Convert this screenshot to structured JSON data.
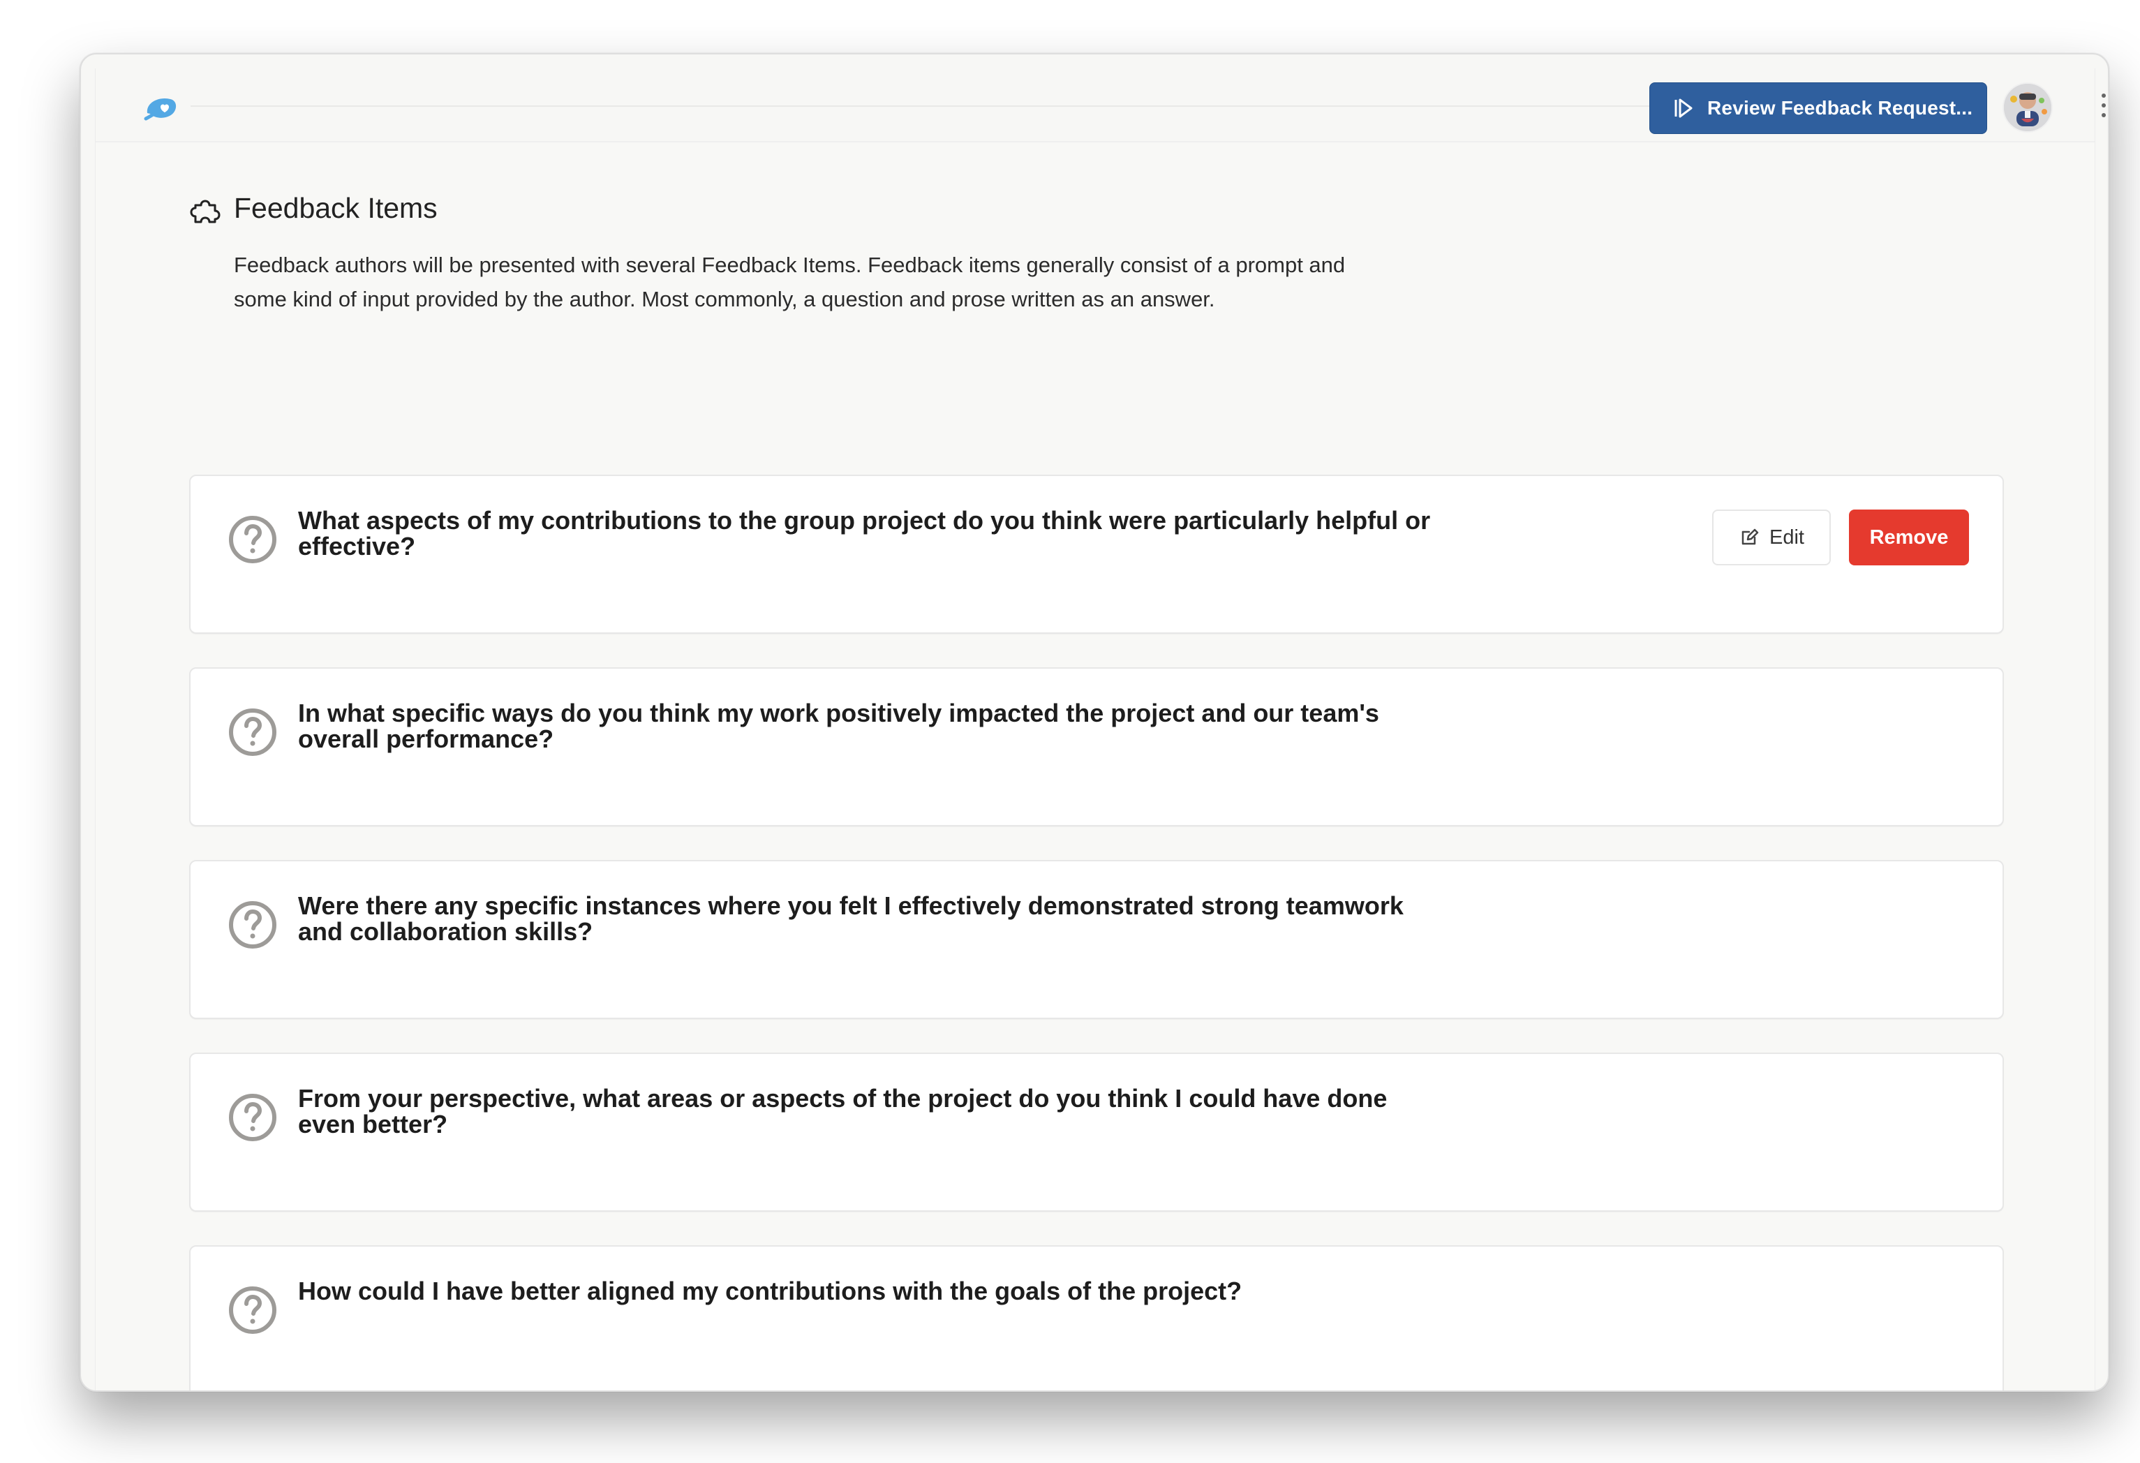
{
  "header": {
    "review_button_label": "Review Feedback Request...",
    "avatar_alt": "User avatar"
  },
  "section": {
    "title": "Feedback Items",
    "description": "Feedback authors will be presented with several Feedback Items. Feedback items generally consist of a prompt and some kind of input provided by the author. Most commonly, a question and prose written as an answer."
  },
  "items": [
    {
      "question": "What aspects of my contributions to the group project do you think were particularly helpful or effective?"
    },
    {
      "question": "In what specific ways do you think my work positively impacted the project and our team's overall performance?"
    },
    {
      "question": "Were there any specific instances where you felt I effectively demonstrated strong teamwork and collaboration skills?"
    },
    {
      "question": "From your perspective, what areas or aspects of the project do you think I could have done even better?"
    },
    {
      "question": "How could I have better aligned my contributions with the goals of the project?"
    }
  ],
  "actions": {
    "edit_label": "Edit",
    "remove_label": "Remove"
  },
  "colors": {
    "primary": "#2f5f9e",
    "danger": "#e53a2e",
    "icon_gray": "#9d9b98",
    "logo_blue": "#53a8e4"
  }
}
